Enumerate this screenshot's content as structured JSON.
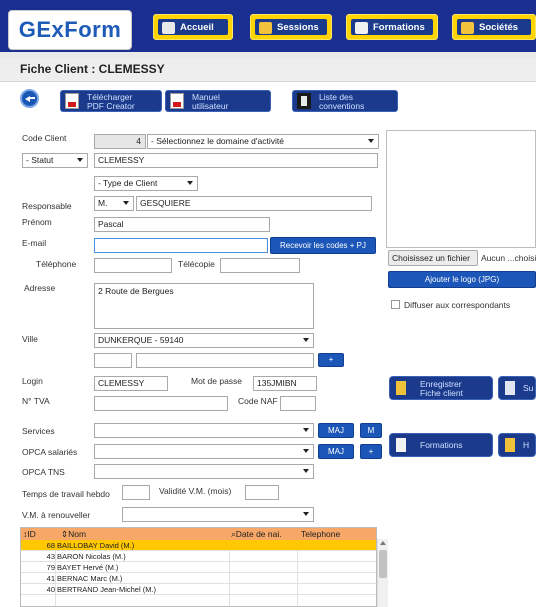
{
  "app": {
    "logo_text": "GExForm"
  },
  "nav": {
    "items": [
      {
        "label": "Accueil",
        "icon": "home-icon"
      },
      {
        "label": "Sessions",
        "icon": "sessions-icon"
      },
      {
        "label": "Formations",
        "icon": "formations-icon"
      },
      {
        "label": "Sociétés",
        "icon": "societes-icon"
      }
    ]
  },
  "page": {
    "title": "Fiche Client : CLEMESSY"
  },
  "toolbar": {
    "pdf_label1": "Télécharger",
    "pdf_label2": "PDF Creator",
    "manual_label1": "Manuel",
    "manual_label2": "utilisateur",
    "conv_label1": "Liste des",
    "conv_label2": "conventions"
  },
  "form": {
    "code_client_label": "Code Client",
    "code_client_value": "4",
    "domaine_select": "- Sélectionnez le domaine d'activité",
    "statut_select": "- Statut",
    "company_name": "CLEMESSY",
    "type_client_select": "- Type de Client",
    "responsable_label": "Responsable",
    "civilite": "M.",
    "nom": "GESQUIERE",
    "prenom_label": "Prénom",
    "prenom": "Pascal",
    "email_label": "E-mail",
    "email_value": "",
    "recevoir_button": "Recevoir les codes + PJ",
    "telephone_label": "Téléphone",
    "telecopie_label": "Télécopie",
    "adresse_label": "Adresse",
    "adresse_value": "2 Route de Bergues",
    "ville_label": "Ville",
    "ville_select": "DUNKERQUE - 59140",
    "plus_label": "+",
    "login_label": "Login",
    "login_value": "CLEMESSY",
    "mdp_label": "Mot de passe",
    "mdp_value": "135JMIBN",
    "tva_label": "N° TVA",
    "naf_label": "Code NAF",
    "services_label": "Services",
    "maj_label": "MAJ",
    "m_label": "M",
    "opca_sal_label": "OPCA salariés",
    "opca_tns_label": "OPCA TNS",
    "temps_label": "Temps de travail hebdo",
    "validite_label": "Validité V.M. (mois)",
    "vm_label": "V.M. à renouveller"
  },
  "side": {
    "file_button": "Choisissez un fichier",
    "file_none": "Aucun ...choisi",
    "logo_button": "Ajouter le logo (JPG)",
    "diffuser_label": "Diffuser aux correspondants",
    "enregistrer1": "Enregistrer",
    "enregistrer2": "Fiche client",
    "sup_label": "Su",
    "formations_label": "Formations",
    "h_label": "H"
  },
  "grid": {
    "headers": {
      "id": "ID",
      "nom": "Nom",
      "date": "Date de nai.",
      "tel": "Telephone"
    },
    "rows": [
      {
        "id": "68",
        "name": "BAILLOBAY David (M.)"
      },
      {
        "id": "43",
        "name": "BARON Nicolas (M.)"
      },
      {
        "id": "79",
        "name": "BAYET Hervé (M.)"
      },
      {
        "id": "41",
        "name": "BERNAC Marc (M.)"
      },
      {
        "id": "40",
        "name": "BERTRAND Jean-Michel (M.)"
      }
    ]
  },
  "colors": {
    "nav_bg": "#1a2f8f",
    "nav_button_border": "#ffd400",
    "button_blue": "#1b56b8",
    "grid_header": "#f7a868",
    "selected_row": "#ffc800"
  }
}
